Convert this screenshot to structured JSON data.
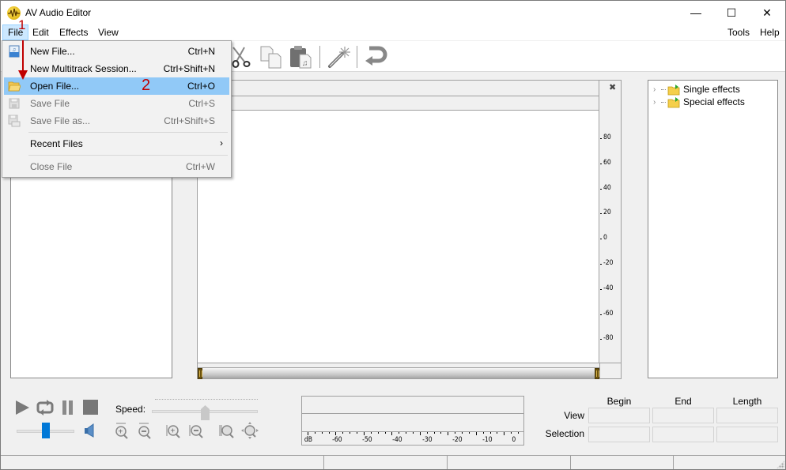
{
  "window": {
    "title": "AV Audio Editor",
    "icon": "waveform-app-icon",
    "controls": {
      "minimize": "—",
      "maximize": "☐",
      "close": "✕"
    }
  },
  "menubar": {
    "items": [
      {
        "label": "File",
        "active": true
      },
      {
        "label": "Edit"
      },
      {
        "label": "Effects"
      },
      {
        "label": "View"
      },
      {
        "label": "Tools"
      },
      {
        "label": "Help"
      }
    ]
  },
  "toolbar": {
    "icons": [
      "cut-icon",
      "copy-icon",
      "paste-icon",
      "magic-wand-icon",
      "undo-icon"
    ]
  },
  "file_menu": {
    "items": [
      {
        "label": "New File...",
        "shortcut": "Ctrl+N",
        "icon": "new-file-icon",
        "enabled": true
      },
      {
        "label": "New Multitrack Session...",
        "shortcut": "Ctrl+Shift+N",
        "enabled": true
      },
      {
        "label": "Open File...",
        "shortcut": "Ctrl+O",
        "icon": "folder-open-icon",
        "enabled": true,
        "highlighted": true
      },
      {
        "label": "Save File",
        "shortcut": "Ctrl+S",
        "icon": "save-icon",
        "enabled": false
      },
      {
        "label": "Save File as...",
        "shortcut": "Ctrl+Shift+S",
        "icon": "save-as-icon",
        "enabled": false
      },
      {
        "label": "Recent Files",
        "submenu": true,
        "arrow": "›",
        "enabled": true
      },
      {
        "label": "Close File",
        "shortcut": "Ctrl+W",
        "enabled": false
      }
    ]
  },
  "annotations": {
    "step1": "1",
    "step2": "2",
    "color": "#c00000"
  },
  "waveform": {
    "close_glyph": "✖",
    "scale_labels": [
      "80",
      "60",
      "40",
      "20",
      "0",
      "-20",
      "-40",
      "-60",
      "-80"
    ]
  },
  "effects_tree": {
    "items": [
      {
        "label": "Single effects",
        "expanded": false
      },
      {
        "label": "Special effects",
        "expanded": false
      }
    ]
  },
  "transport": {
    "speed_label": "Speed:",
    "buttons": [
      "play-icon",
      "loop-icon",
      "pause-icon",
      "stop-icon"
    ],
    "zoom_buttons": [
      "zoom-in-vertical-icon",
      "zoom-out-vertical-icon",
      "zoom-in-horizontal-icon",
      "zoom-out-horizontal-icon",
      "zoom-fit-icon",
      "zoom-all-icon"
    ],
    "speed_position": 0.5,
    "volume_position": 0.5
  },
  "level_meter": {
    "unit": "dB",
    "labels": [
      "-60",
      "-50",
      "-40",
      "-30",
      "-20",
      "-10",
      "0"
    ]
  },
  "position_grid": {
    "columns": [
      "Begin",
      "End",
      "Length"
    ],
    "rows": [
      {
        "label": "View",
        "values": [
          "",
          "",
          ""
        ]
      },
      {
        "label": "Selection",
        "values": [
          "",
          "",
          ""
        ]
      }
    ]
  },
  "colors": {
    "menu_highlight": "#91c9f7",
    "menu_active": "#cce8ff",
    "volume_thumb": "#0078d7",
    "scroll_handle": "#6a5210"
  }
}
